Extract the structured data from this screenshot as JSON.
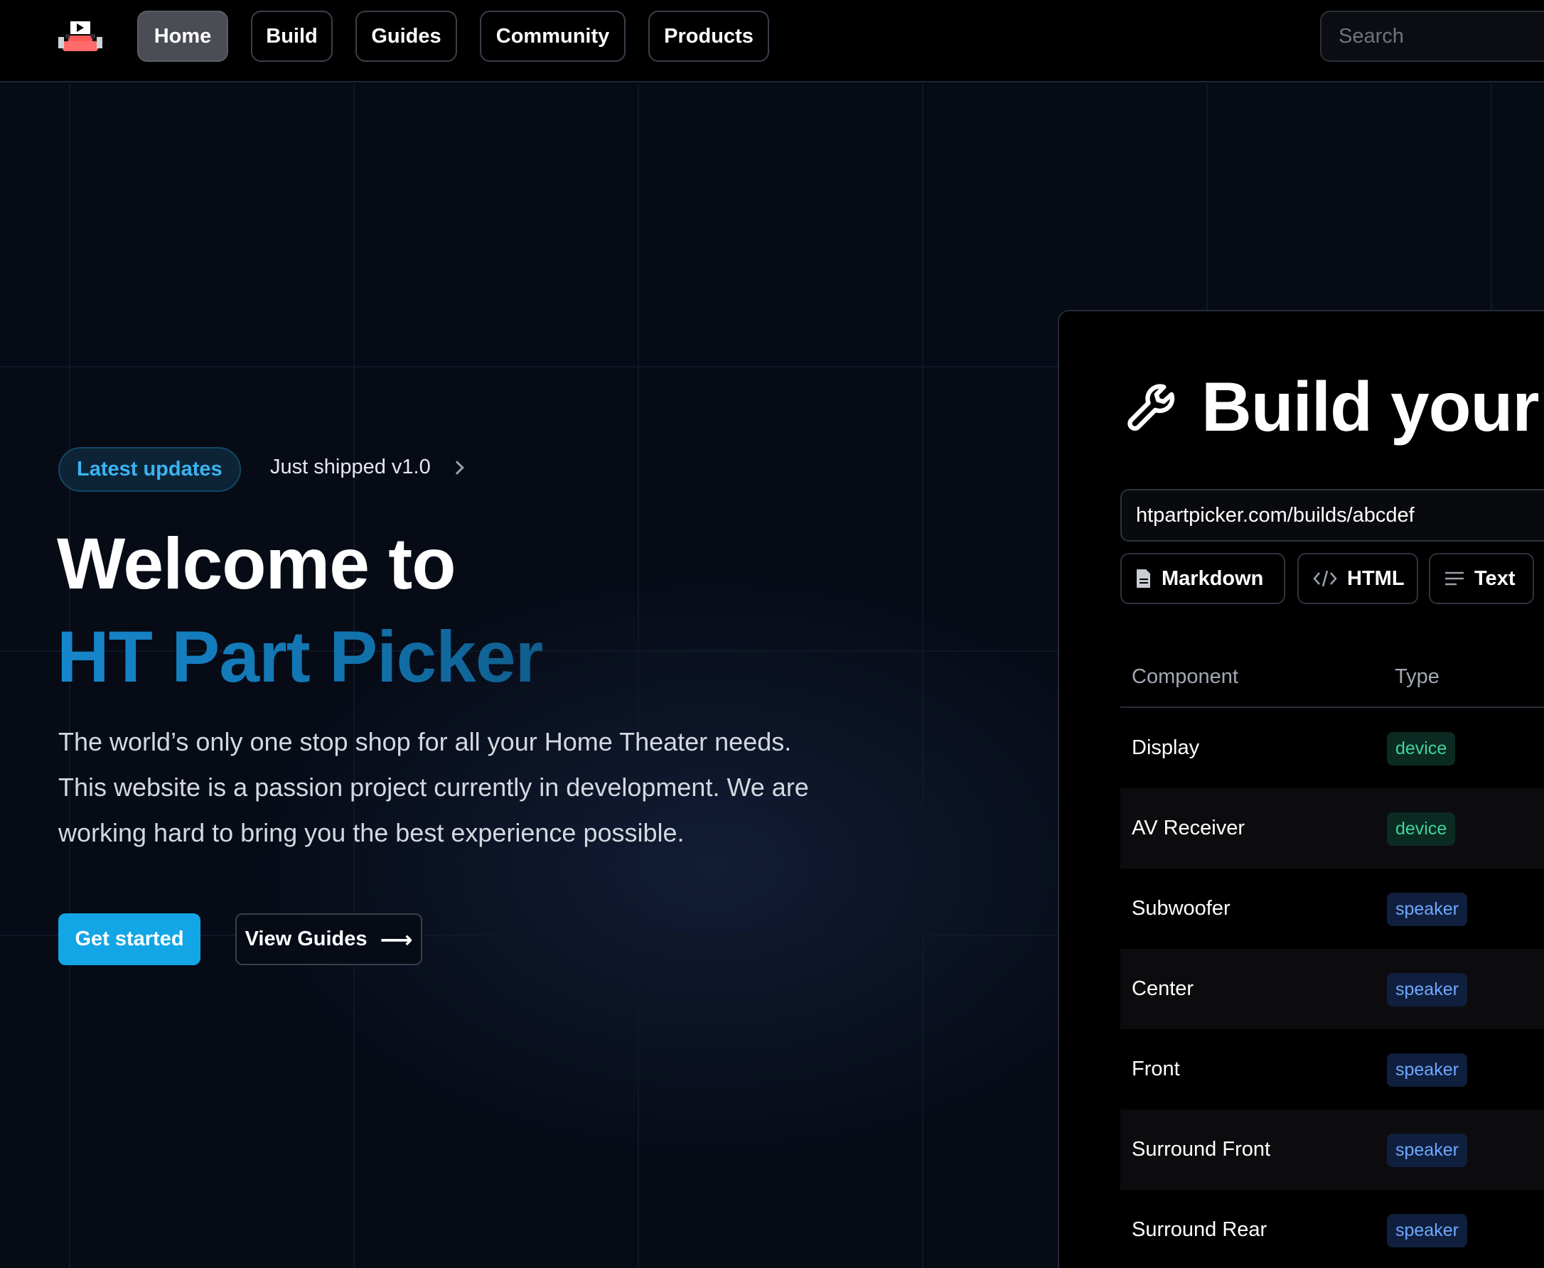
{
  "nav": {
    "items": [
      {
        "label": "Home",
        "active": true
      },
      {
        "label": "Build",
        "active": false
      },
      {
        "label": "Guides",
        "active": false
      },
      {
        "label": "Community",
        "active": false
      },
      {
        "label": "Products",
        "active": false
      }
    ],
    "search_placeholder": "Search"
  },
  "hero": {
    "badge": "Latest updates",
    "shipped": "Just shipped v1.0",
    "title_line1": "Welcome to",
    "title_line2": "HT Part Picker",
    "description_lines": [
      "The world’s only one stop shop for all your Home Theater needs.",
      "This website is a passion project currently in development. We are",
      "working hard to bring you the best experience possible."
    ],
    "primary_cta": "Get started",
    "secondary_cta": "View Guides",
    "secondary_cta_arrow": "⟶"
  },
  "panel": {
    "title": "Build your",
    "url": "htpartpicker.com/builds/abcdef",
    "formats": [
      "Markdown",
      "HTML",
      "Text"
    ],
    "columns": [
      "Component",
      "Type"
    ],
    "rows": [
      {
        "component": "Display",
        "type": "device"
      },
      {
        "component": "AV Receiver",
        "type": "device"
      },
      {
        "component": "Subwoofer",
        "type": "speaker"
      },
      {
        "component": "Center",
        "type": "speaker"
      },
      {
        "component": "Front",
        "type": "speaker"
      },
      {
        "component": "Surround Front",
        "type": "speaker"
      },
      {
        "component": "Surround Rear",
        "type": "speaker"
      }
    ]
  },
  "colors": {
    "accent": "#12a6e6",
    "title_blue": "#1686cc",
    "device_tag": "#3fd49a",
    "speaker_tag": "#6ea8ff"
  },
  "icons": {
    "logo": "theater-logo-icon",
    "wrench": "wrench-icon",
    "markdown": "document-icon",
    "html": "code-icon",
    "text": "text-lines-icon",
    "shipped": "chevron-right-icon"
  }
}
